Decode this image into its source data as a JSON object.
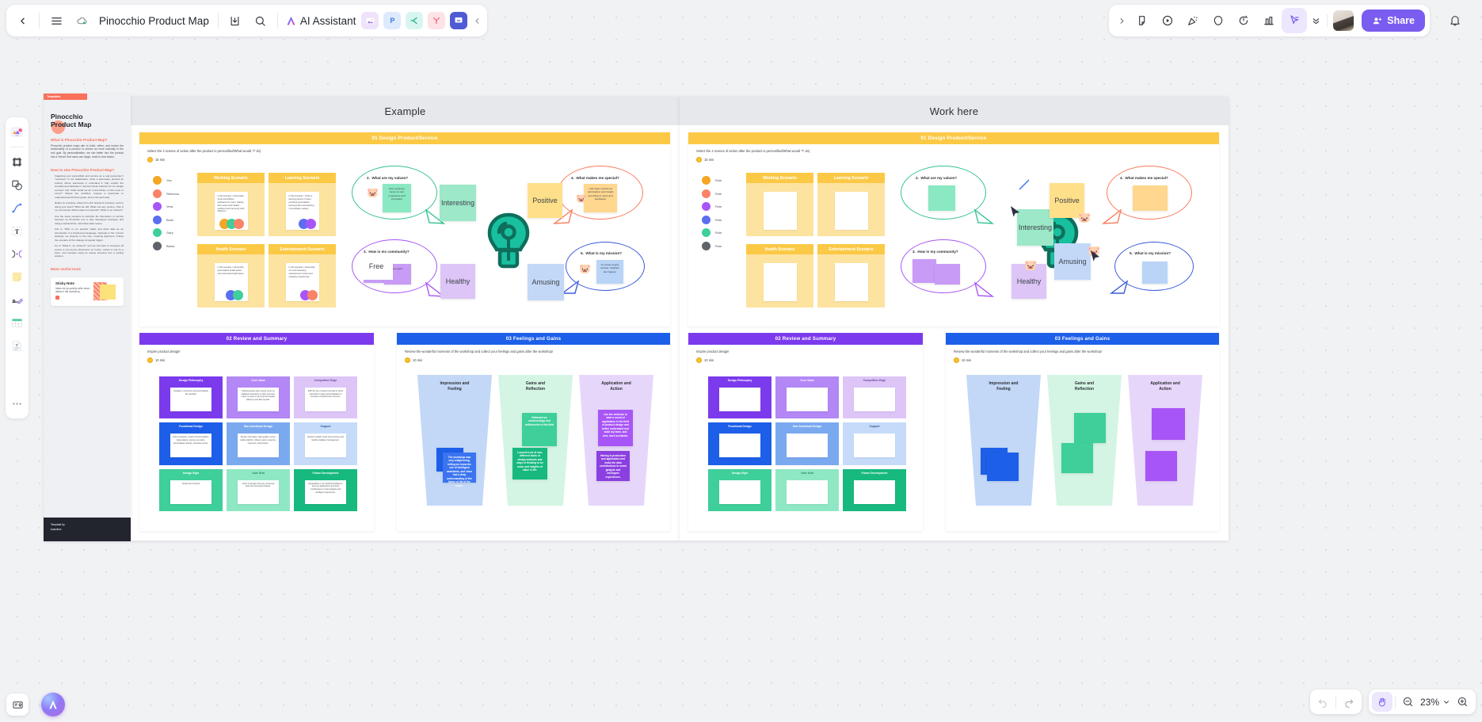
{
  "app": {
    "doc_title": "Pinocchio Product Map",
    "ai_label": "AI Assistant",
    "share_label": "Share",
    "zoom_level": "23%"
  },
  "topbar_left_icons": [
    {
      "name": "back-icon",
      "glyph": "‹"
    },
    {
      "name": "menu-icon",
      "glyph": "☰"
    },
    {
      "name": "cloud-sync-icon",
      "glyph": "☁"
    },
    {
      "name": "download-icon",
      "glyph": "⤓"
    },
    {
      "name": "search-icon",
      "glyph": "⌕"
    }
  ],
  "topbar_left_applets": [
    {
      "name": "image-applet",
      "label": "",
      "color": "#efe3fb"
    },
    {
      "name": "presentation-applet",
      "label": "P",
      "color": "#ddeafd"
    },
    {
      "name": "mindmap-applet",
      "label": "",
      "color": "#d8f6ef"
    },
    {
      "name": "flowchart-applet",
      "label": "",
      "color": "#fde2e6"
    },
    {
      "name": "comment-applet",
      "label": "",
      "color": "#dde1fb"
    },
    {
      "name": "collapse-applets-icon",
      "label": "‹",
      "color": "transparent"
    }
  ],
  "topbar_right_icons": [
    {
      "name": "expand-toolbar-icon",
      "glyph": "›"
    },
    {
      "name": "sticky-note-icon",
      "glyph": "Ὕ2"
    },
    {
      "name": "play-record-icon",
      "glyph": "▶"
    },
    {
      "name": "celebrate-icon",
      "glyph": "✨"
    },
    {
      "name": "comment-bubble-icon",
      "glyph": "◯"
    },
    {
      "name": "timer-icon",
      "glyph": "⏱"
    },
    {
      "name": "vote-chart-icon",
      "glyph": "ὌA"
    },
    {
      "name": "cursor-select-icon",
      "glyph": "➤"
    },
    {
      "name": "more-tools-icon",
      "glyph": "»"
    }
  ],
  "left_tools": [
    {
      "name": "tool-templates",
      "label": "Templates"
    },
    {
      "name": "tool-frame",
      "label": "Frame"
    },
    {
      "name": "tool-shape",
      "label": "Shape"
    },
    {
      "name": "tool-connector",
      "label": "Connector"
    },
    {
      "name": "tool-text",
      "label": "Text"
    },
    {
      "name": "tool-mindmap",
      "label": "Mind Map"
    },
    {
      "name": "tool-sticky-note",
      "label": "Sticky Note"
    },
    {
      "name": "tool-pen",
      "label": "Pen"
    },
    {
      "name": "tool-table",
      "label": "Table"
    },
    {
      "name": "tool-document",
      "label": "Document"
    },
    {
      "name": "tool-more",
      "label": "More"
    }
  ],
  "bottom_left": [
    {
      "name": "minimap-button",
      "label": "Minimap"
    },
    {
      "name": "ai-assistant-button",
      "label": "AI"
    }
  ],
  "bottom_right": {
    "undo_label": "Undo",
    "redo_label": "Redo",
    "hand_label": "Hand tool",
    "zoom_out_label": "Zoom out",
    "zoom_in_label": "Zoom in",
    "zoom_value": "23%"
  },
  "template_card": {
    "tag": "Templates",
    "title": "Pinocchio\nProduct Map",
    "h_what": "What is Pinocchio Product Map?",
    "p_what": "Pinocchio product maps aim to build, refine, and evolve the functionality of a product or service as more naturally in the end goal. By personalization, we can better turn the product into a \"friend\" that users can laugh, react to love teams.",
    "h_how": "How to Use Pinocchio Product Map?",
    "bullets": [
      "Imagining your personified and service as a real person/as if \"someone\" is our stakeholder. Invite a teammate, present an entirety where teammate is embodied in fully explain the scenario and rationale in \"become these features for our design concept\" and \"what would we do in this library on this soon to occur?\" Before the workflow, request a teammate to understand and fit their goals, and to tell each task.",
      "Refine its creativity, collect from the brands & functions, and try doing your team? What we did, What role any service, How is my community, What makes me special?, What is my mission?",
      "Use the same sessions to describe the discussion or service because its Pinocchio use a fully developed prototype and rising emotional bits, call whole table teams.",
      "Ask to \"Who is me special\" walks and draw data as an introduction in a brand-level language, rationale to the \"current strategy\" we propose in the core, meaning tight-term. Follow the scenario of the strategy at regular trigger.",
      "Go to \"What is my mission?\" and we still want to compose off course a one-to-one discussion of course, collect a role by a team, and consider using its unique structure into a solving solution.",
      "Go to \"Who is my mission?\" realize and draw data as an introduction in a role-level language, rationale to the \"capital market\" we propose in the core, meaning tight-term. What is the discussion to the scene? What are the workshop to this one, for a note?"
    ],
    "h_tools": "More useful tools",
    "sticky_title": "Sticky Note",
    "sticky_text": "Ideas for by quickly write down ideas in the workshop."
  },
  "boards": [
    {
      "name": "example-board",
      "title": "Example"
    },
    {
      "name": "work-board",
      "title": "Work here"
    }
  ],
  "sections": {
    "s01": {
      "title": "01 Design Product/Service",
      "color": "#fbc945",
      "sub": "Select the 4 scenes of action after the product is personified/What would \"I\" do)",
      "timer": "15 min"
    },
    "s02": {
      "title": "02 Review and Summary",
      "color": "#7c3aed",
      "sub": "Inspire product design!",
      "timer": "10 min"
    },
    "s03": {
      "title": "03 Feelings and Gains",
      "color": "#1d5fe8",
      "sub": "Review the wonderful moments of the workshop and collect your feelings and gains after the workshop!",
      "timer": "10 min"
    }
  },
  "legend": [
    {
      "name": "Yan",
      "color": "#f5a623"
    },
    {
      "name": "Rebecca",
      "color": "#fa8267"
    },
    {
      "name": "Vera",
      "color": "#a855f7"
    },
    {
      "name": "Boris",
      "color": "#5b6ef0"
    },
    {
      "name": "Gary",
      "color": "#3ecf9a"
    },
    {
      "name": "Biana",
      "color": "#5f636b"
    }
  ],
  "scenarios": [
    {
      "title": "Working Scenario",
      "note": "In this scenario, I will provide smart and efficient assistance for users, helping them solve work-related problems and improving work efficiency.",
      "dots": [
        "#f5a623",
        "#3ecf9a",
        "#fa8267"
      ]
    },
    {
      "title": "Learning Scenario",
      "note": "In this scenario, I will be a learning partner of users, providing personalised learning plans and assisting in knowledge mastery.",
      "dots": [
        "#5b6ef0",
        "#a855f7"
      ]
    },
    {
      "title": "Health Scenario",
      "note": "In this scenario, I will provide personalised health advice and customised health plans.",
      "dots": [
        "#5b6ef0",
        "#3ecf9a"
      ]
    },
    {
      "title": "Entertainment Scenario",
      "note": "In this scenario, I will provide rich and interesting entertainment content and relaxation experiences.",
      "dots": [
        "#a855f7",
        "#fa8267"
      ]
    }
  ],
  "bubbles": [
    {
      "n": "2.",
      "q": "What are my values?",
      "color": "#34c38f",
      "note": "User-centered, focus on user experience and innovation",
      "note_color": "#8ae8c2"
    },
    {
      "n": "3.",
      "q": "How is my community?",
      "color": "#a855f7",
      "note": "Energetic",
      "note_color": "#c89bf7"
    },
    {
      "n": "4.",
      "q": "What makes me special?",
      "color": "#fa7a5c",
      "note": "I will make continuous optimisation and insight according to users and feedbacks",
      "note_color": "#ffd78f"
    },
    {
      "n": "5.",
      "q": "What is my mission?",
      "color": "#3b5bdb",
      "note": "To create people smarter, healthier and happier",
      "note_color": "#b9d4f7"
    }
  ],
  "feeling_notes": [
    {
      "text": "Interesting",
      "color": "#9ce8c8"
    },
    {
      "text": "Positive",
      "color": "#ffe08a"
    },
    {
      "text": "Free",
      "color": "#ffffff"
    },
    {
      "text": "Healthy",
      "color": "#ddc5f7"
    },
    {
      "text": "Amusing",
      "color": "#c3d8f7"
    }
  ],
  "review_grid": [
    {
      "label": "Design Philosophy",
      "color": "#7c3aed",
      "note": "Intelligent, convenient and personalised life assistant"
    },
    {
      "label": "Core Value",
      "color": "#b387f5",
      "note": "Helping people save energy, focus on intelligent assistance to offer and work-ready, to enjoy a truly improved quality efficiency and little specific."
    },
    {
      "label": "Competitive Edge",
      "color": "#ddc5f7",
      "note": "With the use of deep-level data to refine and deliver unique personalisation to increase comprehensive services."
    },
    {
      "label": "Functional Design",
      "color": "#1d5fe8",
      "note": "Voice interaction, smart recommendation, data analysis, precise execution, personalised settings, schedule service."
    },
    {
      "label": "Non-functional Design",
      "color": "#7aa9f0",
      "note": "Simple, informative, high-quality, secure, stable platform, offered, quick, response, improved, performance."
    },
    {
      "label": "Support",
      "color": "#c6dbfa",
      "note": "Support multiple smart home devices and flexible intelligent management."
    },
    {
      "label": "Design Style",
      "color": "#3ecf9a",
      "note": "Simple and minimal"
    },
    {
      "label": "User Grid",
      "color": "#8fe8c4",
      "note": "Users of all ages who are concerned about the personal products."
    },
    {
      "label": "Future Development",
      "color": "#17b97f",
      "note": "Expandable to use artificial intelligence and new applications and deep contributions to smart gadgets and intelligent experiences."
    }
  ],
  "funnels": [
    {
      "title": "Impression and\nFeeling",
      "color": "#c3d8f7",
      "notes": [
        {
          "color": "#1d5fe8",
          "text": ""
        },
        {
          "color": "#3b74ef",
          "text": "The workshop was very enlightening, letting me know the use of intelligent assistants, and I also had a deep understanding of the future of life of the users."
        }
      ]
    },
    {
      "title": "Gains and\nReflection",
      "color": "#d4f5e3",
      "notes": [
        {
          "color": "#3ecf9a",
          "text": "Reflected on shortcomings and deficiencies in this field"
        },
        {
          "color": "#17b97f",
          "text": "Learned a lot of new, different kinds of design methods and ways of thinking to be used, and insights of value in life."
        }
      ]
    },
    {
      "title": "Application and\nAction",
      "color": "#e6d7fa",
      "notes": [
        {
          "color": "#a855f7",
          "text": "Use the methods to start a round of application in the field of product design and better understand and build my team, and new, more scenarios."
        },
        {
          "color": "#8b3fe0",
          "text": "Having in production and application and make the data contributions to smart gadgets and intelligent experiences."
        }
      ]
    }
  ]
}
